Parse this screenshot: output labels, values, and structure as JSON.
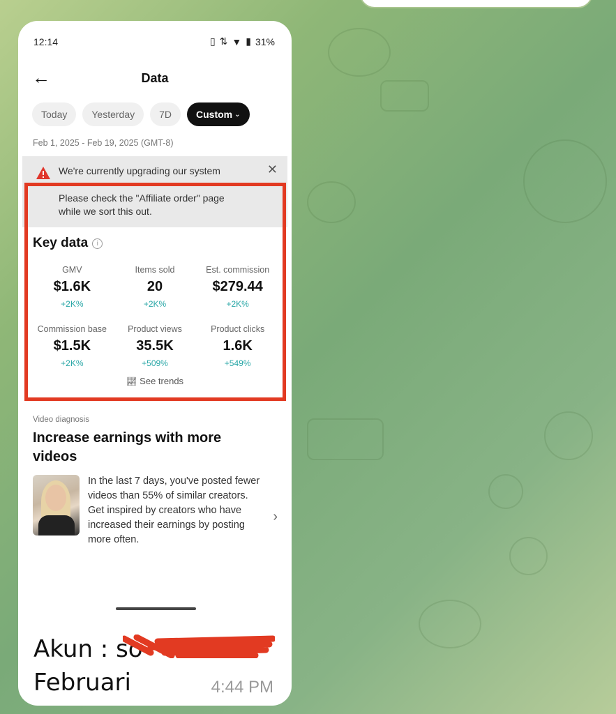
{
  "status_bar": {
    "time": "12:14",
    "battery": "31%"
  },
  "nav": {
    "title": "Data"
  },
  "filters": [
    {
      "label": "Today",
      "active": false
    },
    {
      "label": "Yesterday",
      "active": false
    },
    {
      "label": "7D",
      "active": false
    },
    {
      "label": "Custom",
      "active": true
    }
  ],
  "date_range": "Feb 1, 2025 - Feb 19, 2025 (GMT-8)",
  "alert": {
    "line1": "We're currently upgrading our system",
    "line2": "Please check the \"Affiliate order\" page",
    "line3": "while we sort this out."
  },
  "key_data": {
    "title": "Key data",
    "metrics": [
      {
        "label": "GMV",
        "value": "$1.6K",
        "delta": "+2K%"
      },
      {
        "label": "Items sold",
        "value": "20",
        "delta": "+2K%"
      },
      {
        "label": "Est. commission",
        "value": "$279.44",
        "delta": "+2K%"
      },
      {
        "label": "Commission base",
        "value": "$1.5K",
        "delta": "+2K%"
      },
      {
        "label": "Product views",
        "value": "35.5K",
        "delta": "+509%"
      },
      {
        "label": "Product clicks",
        "value": "1.6K",
        "delta": "+549%"
      }
    ],
    "see_trends": "See trends"
  },
  "video_diagnosis": {
    "kicker": "Video diagnosis",
    "title": "Increase earnings with more videos",
    "body": "In the last 7 days, you've posted fewer videos than 55% of similar creators. Get inspired by creators who have increased their earnings by posting more often."
  },
  "message": {
    "line1": "Akun : so",
    "line2": "Februari",
    "time": "4:44 PM"
  },
  "colors": {
    "highlight": "#e23a22",
    "delta": "#2aa7a7",
    "chat_bg": "#8fb777"
  }
}
